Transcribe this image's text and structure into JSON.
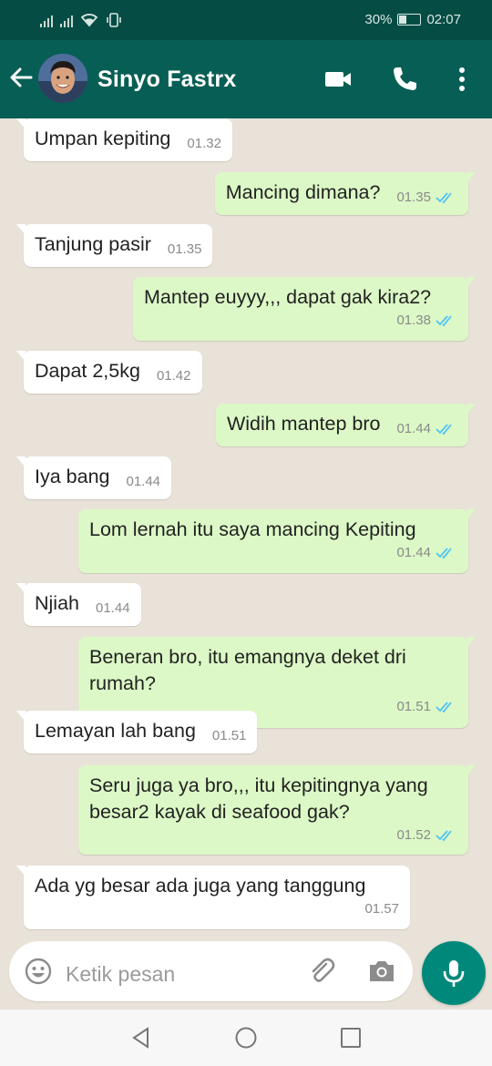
{
  "status_bar": {
    "battery": "30%",
    "time": "02:07"
  },
  "header": {
    "contact_name": "Sinyo Fastrx"
  },
  "messages": [
    {
      "dir": "in",
      "text": "Umpan kepiting",
      "time": "01.32"
    },
    {
      "dir": "out",
      "text": "Mancing dimana?",
      "time": "01.35"
    },
    {
      "dir": "in",
      "text": "Tanjung pasir",
      "time": "01.35"
    },
    {
      "dir": "out",
      "text": "Mantep euyyy,,, dapat gak kira2?",
      "time": "01.38"
    },
    {
      "dir": "in",
      "text": "Dapat 2,5kg",
      "time": "01.42"
    },
    {
      "dir": "out",
      "text": "Widih mantep bro",
      "time": "01.44"
    },
    {
      "dir": "in",
      "text": "Iya bang",
      "time": "01.44"
    },
    {
      "dir": "out",
      "text": "Lom lernah itu saya mancing Kepiting",
      "time": "01.44"
    },
    {
      "dir": "in",
      "text": "Njiah",
      "time": "01.44"
    },
    {
      "dir": "out",
      "text": "Beneran bro, itu emangnya deket dri rumah?",
      "time": "01.51"
    },
    {
      "dir": "in",
      "text": "Lemayan lah bang",
      "time": "01.51"
    },
    {
      "dir": "out",
      "text": "Seru juga ya bro,,, itu kepitingnya yang besar2 kayak di seafood gak?",
      "time": "01.52"
    },
    {
      "dir": "in",
      "text": "Ada yg besar ada juga yang tanggung",
      "time": "01.57"
    }
  ],
  "composer": {
    "placeholder": "Ketik pesan"
  },
  "colors": {
    "header": "#075e54",
    "status": "#054d44",
    "outgoing": "#dcf8c6",
    "fab": "#00897b",
    "read_ticks": "#4fc3f7"
  },
  "icons": [
    "back-arrow-icon",
    "video-call-icon",
    "phone-icon",
    "more-vert-icon",
    "emoji-icon",
    "attach-icon",
    "camera-icon",
    "mic-icon"
  ]
}
